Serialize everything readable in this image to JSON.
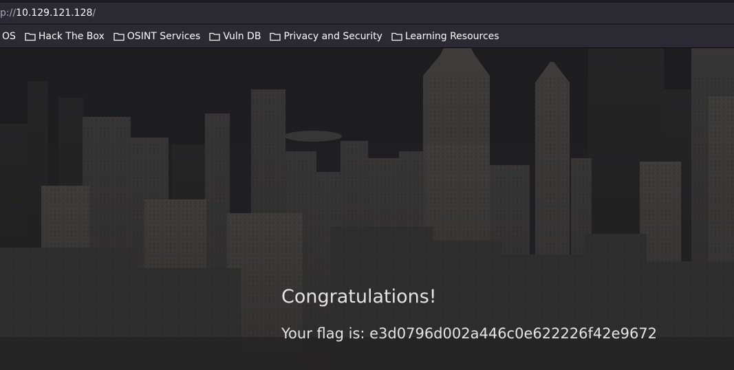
{
  "browser": {
    "url_scheme": "p://",
    "url_host": "10.129.121.128",
    "url_path": "/"
  },
  "bookmarks": {
    "first_label": "OS",
    "items": [
      {
        "label": "Hack The Box",
        "icon": "folder-icon"
      },
      {
        "label": "OSINT Services",
        "icon": "folder-icon"
      },
      {
        "label": "Vuln DB",
        "icon": "folder-icon"
      },
      {
        "label": "Privacy and Security",
        "icon": "folder-icon"
      },
      {
        "label": "Learning Resources",
        "icon": "folder-icon"
      }
    ]
  },
  "page": {
    "title": "Congratulations!",
    "flag_text": "Your flag is: e3d0796d002a446c0e622226f42e9672"
  },
  "colors": {
    "toolbar_bg": "#2b2a33",
    "page_text": "#e4e4e4"
  }
}
